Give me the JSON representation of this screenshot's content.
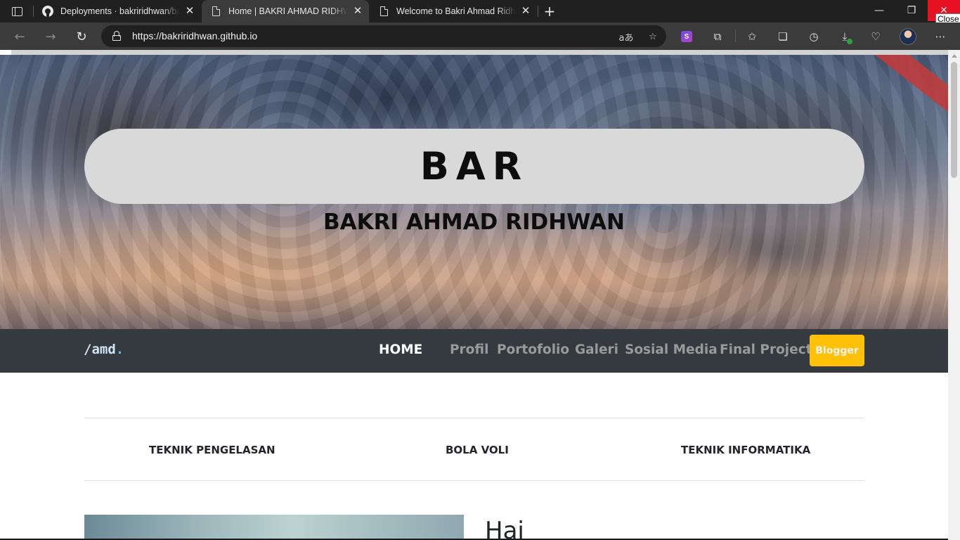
{
  "browser": {
    "tabs": [
      {
        "title": "Deployments · bakriridhwan/bakriridhwan.github.io",
        "icon": "github-icon",
        "active": false
      },
      {
        "title": "Home | BAKRI AHMAD RIDHWAN",
        "icon": "page-icon",
        "active": true
      },
      {
        "title": "Welcome to Bakri Ahmad Ridhwan",
        "icon": "page-icon",
        "active": false
      }
    ],
    "tooltip": "Close",
    "address": "https://bakriridhwan.github.io",
    "extension_letter": "S"
  },
  "hero": {
    "title": "BAR",
    "subtitle": "BAKRI AHMAD RIDHWAN"
  },
  "navbar": {
    "brand": "/amd",
    "brand_dot": ".",
    "links": [
      "HOME",
      "Profil",
      "Portofolio",
      "Galeri",
      "Sosial Media",
      "Final Project"
    ],
    "active_link": "HOME",
    "blogger_label": "Blogger"
  },
  "categories": [
    "TEKNIK PENGELASAN",
    "BOLA VOLI",
    "TEKNIK INFORMATIKA"
  ],
  "intro": {
    "heading": "Hai"
  },
  "colors": {
    "navbar_bg": "#343a40",
    "blogger_bg": "#ffc107",
    "close_button": "#e81123"
  }
}
